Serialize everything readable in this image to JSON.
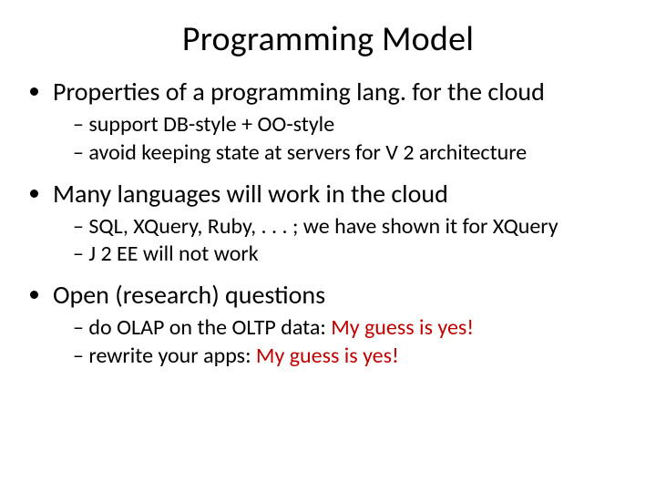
{
  "title": "Programming Model",
  "bullets": {
    "b1": {
      "text": "Properties of a programming lang. for the cloud",
      "sub": {
        "s1": "support DB-style + OO-style",
        "s2": "avoid keeping state at servers for V 2 architecture"
      }
    },
    "b2": {
      "text": "Many languages will work in the cloud",
      "sub": {
        "s1": "SQL, XQuery, Ruby, . . . ;  we have shown it for XQuery",
        "s2": "J 2 EE will not work"
      }
    },
    "b3": {
      "text": "Open (research) questions",
      "sub": {
        "s1a": "do OLAP on the OLTP data: ",
        "s1b": "My guess is yes!",
        "s2a": "rewrite your apps: ",
        "s2b": "My guess is yes!"
      }
    }
  }
}
